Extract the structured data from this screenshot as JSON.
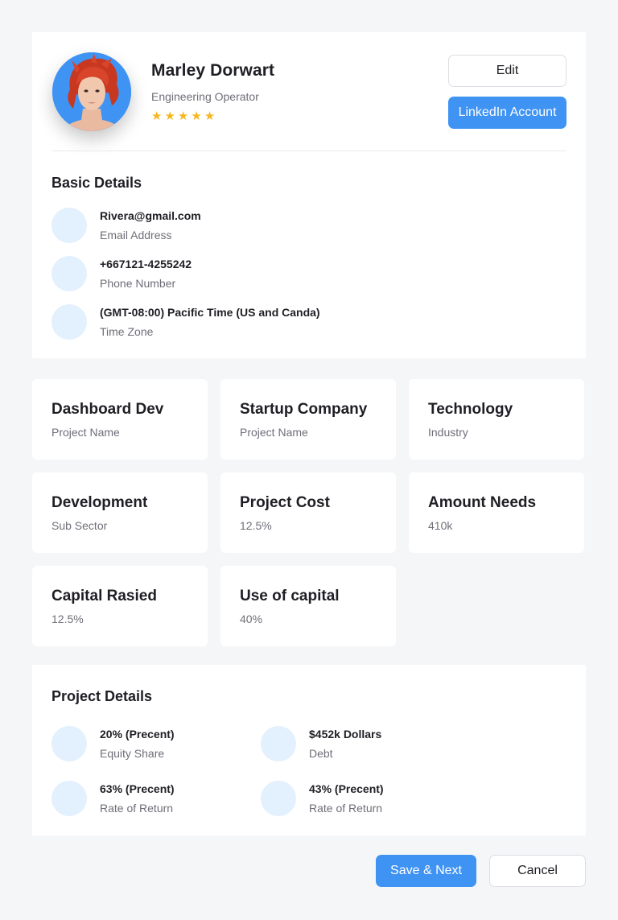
{
  "profile": {
    "name": "Marley Dorwart",
    "role": "Engineering Operator",
    "rating": 5,
    "stars": [
      "★",
      "★",
      "★",
      "★",
      "★"
    ],
    "edit_label": "Edit",
    "linkedin_label": "LinkedIn Account"
  },
  "basic_details": {
    "title": "Basic Details",
    "items": [
      {
        "value": "Rivera@gmail.com",
        "label": "Email Address"
      },
      {
        "value": "+667121-4255242",
        "label": "Phone Number"
      },
      {
        "value": "(GMT-08:00) Pacific Time (US and Canda)",
        "label": "Time Zone"
      }
    ]
  },
  "tiles": [
    {
      "value": "Dashboard Dev",
      "label": "Project Name"
    },
    {
      "value": "Startup Company",
      "label": "Project Name"
    },
    {
      "value": "Technology",
      "label": "Industry"
    },
    {
      "value": "Development",
      "label": "Sub Sector"
    },
    {
      "value": "Project Cost",
      "label": "12.5%"
    },
    {
      "value": "Amount Needs",
      "label": "410k"
    },
    {
      "value": "Capital Rasied",
      "label": "12.5%"
    },
    {
      "value": "Use of capital",
      "label": "40%"
    }
  ],
  "project_details": {
    "title": "Project Details",
    "items": [
      {
        "value": "20% (Precent)",
        "label": "Equity Share"
      },
      {
        "value": "$452k Dollars",
        "label": "Debt"
      },
      {
        "value": "63% (Precent)",
        "label": "Rate of Return"
      },
      {
        "value": "43% (Precent)",
        "label": "Rate of Return"
      }
    ]
  },
  "footer": {
    "save_label": "Save & Next",
    "cancel_label": "Cancel"
  },
  "colors": {
    "accent": "#3f93f3",
    "star": "#f5b81f",
    "icon_circle": "#e3f0fd",
    "background": "#f5f6f8"
  }
}
